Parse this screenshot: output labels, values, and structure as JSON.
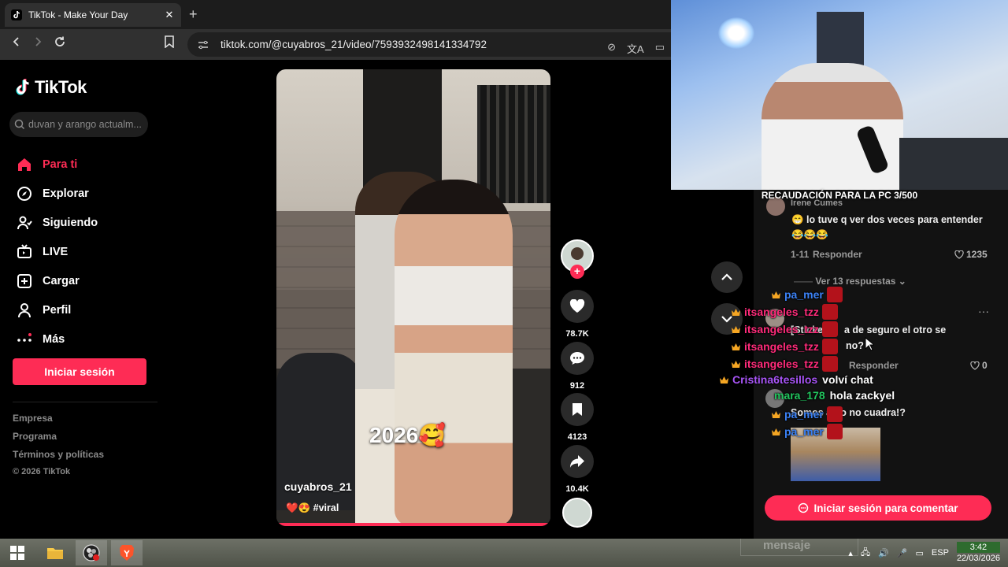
{
  "browser": {
    "tab_title": "TikTok - Make Your Day",
    "tab_close": "✕",
    "new_tab": "+",
    "url": "tiktok.com/@cuyabros_21/video/7593932498141334792"
  },
  "tiktok": {
    "logo_text": "TikTok",
    "search_placeholder": "duvan y arango actualm...",
    "nav": [
      {
        "label": "Para ti",
        "icon": "home-icon"
      },
      {
        "label": "Explorar",
        "icon": "compass-icon"
      },
      {
        "label": "Siguiendo",
        "icon": "following-icon"
      },
      {
        "label": "LIVE",
        "icon": "live-tv-icon"
      },
      {
        "label": "Cargar",
        "icon": "upload-icon"
      },
      {
        "label": "Perfil",
        "icon": "profile-icon"
      },
      {
        "label": "Más",
        "icon": "more-icon"
      }
    ],
    "login_button": "Iniciar sesión",
    "footer": [
      "Empresa",
      "Programa",
      "Términos y políticas",
      "© 2026 TikTok"
    ],
    "accent_color": "#fe2c55"
  },
  "video": {
    "overlay_text": "2026🥰",
    "author": "cuyabros_21",
    "caption_emojis": "❤️😍",
    "hashtag": "#viral",
    "progress": 1.0
  },
  "actions": {
    "likes": "78.7K",
    "comments": "912",
    "saves": "4123",
    "shares": "10.4K",
    "follow_plus": "+"
  },
  "stream_overlay": {
    "goal_banner": "RECAUDACIÓN PARA LA PC 3/500",
    "chat": [
      {
        "user": "pa_mer",
        "color": "#3b82f6",
        "message": ""
      },
      {
        "user": "itsangeles_tzz",
        "color": "#ff2b7a",
        "message": ""
      },
      {
        "user": "itsangeles_tzz",
        "color": "#ff2b7a",
        "message": ""
      },
      {
        "user": "itsangeles_tzz",
        "color": "#ff2b7a",
        "message": ""
      },
      {
        "user": "itsangeles_tzz",
        "color": "#ff2b7a",
        "message": ""
      },
      {
        "user": "Cristina6tesillos",
        "color": "#a855f7",
        "message": "volví chat"
      },
      {
        "user": "mara_178",
        "color": "#22c55e",
        "message": "hola zackyel"
      },
      {
        "user": "pa_mer",
        "color": "#3b82f6",
        "message": ""
      },
      {
        "user": "pa_mer",
        "color": "#3b82f6",
        "message": ""
      }
    ]
  },
  "comments": {
    "c1_name": "Irene Cumes",
    "c1_text": "😁 lo tuve q ver dos veces para entender 😂😂😂",
    "c1_date": "1-11",
    "c1_reply": "Responder",
    "c1_likes": "1235",
    "view_replies": "Ver 13 respuestas",
    "c2_text_a": "[Sticker]",
    "c2_text_b": "a de seguro el otro se",
    "c2_text_c": "no?",
    "c2_reply": "Responder",
    "c2_likes": "0",
    "c3_text": "Somos algo no cuadra!?",
    "login_to_comment": "Iniciar sesión para comentar"
  },
  "taskbar": {
    "ghost_input": "mensaje",
    "lang": "ESP",
    "time": "3:42",
    "date": "22/03/2026"
  }
}
